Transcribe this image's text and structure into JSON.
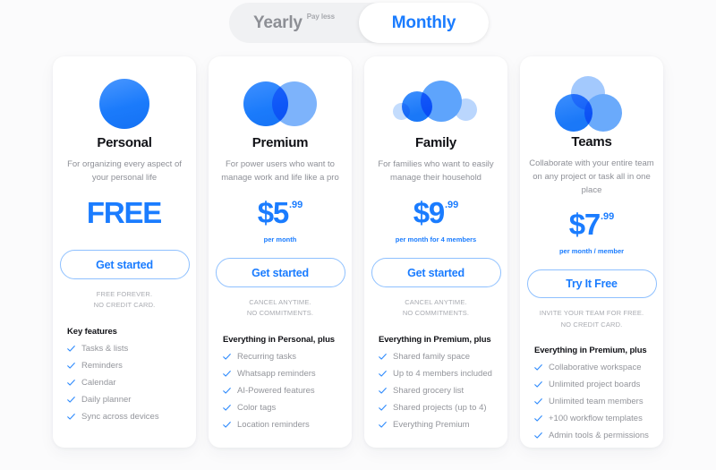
{
  "billing_toggle": {
    "options": [
      {
        "label": "Yearly",
        "badge": "Pay less",
        "selected": false
      },
      {
        "label": "Monthly",
        "badge": "",
        "selected": true
      }
    ]
  },
  "accent_color": "#1a7cff",
  "plans": [
    {
      "name": "Personal",
      "icon": "one-circle-icon",
      "description": "For organizing every aspect of your personal life",
      "price_main": "FREE",
      "price_cents": "",
      "price_period": "",
      "cta_label": "Get started",
      "fineprint": "FREE FOREVER.\nNO CREDIT CARD.",
      "features_heading": "Key features",
      "features": [
        "Tasks & lists",
        "Reminders",
        "Calendar",
        "Daily planner",
        "Sync across devices"
      ]
    },
    {
      "name": "Premium",
      "icon": "two-circles-icon",
      "description": "For power users who want to manage work and life like a pro",
      "price_main": "$5",
      "price_cents": ".99",
      "price_period": "per month",
      "cta_label": "Get started",
      "fineprint": "CANCEL ANYTIME.\nNO COMMITMENTS.",
      "features_heading": "Everything in Personal, plus",
      "features": [
        "Recurring tasks",
        "Whatsapp reminders",
        "AI-Powered features",
        "Color tags",
        "Location reminders"
      ]
    },
    {
      "name": "Family",
      "icon": "four-circles-icon",
      "description": "For families who want to easily manage their household",
      "price_main": "$9",
      "price_cents": ".99",
      "price_period": "per month for 4 members",
      "cta_label": "Get started",
      "fineprint": "CANCEL ANYTIME.\nNO COMMITMENTS.",
      "features_heading": "Everything in Premium, plus",
      "features": [
        "Shared family space",
        "Up to 4 members included",
        "Shared grocery list",
        "Shared projects (up to 4)",
        "Everything Premium"
      ]
    },
    {
      "name": "Teams",
      "icon": "three-circles-icon",
      "description": "Collaborate with your entire team on any project or task all in one place",
      "price_main": "$7",
      "price_cents": ".99",
      "price_period": "per month / member",
      "cta_label": "Try It Free",
      "fineprint": "INVITE YOUR TEAM FOR FREE.\nNO CREDIT CARD.",
      "features_heading": "Everything in Premium, plus",
      "features": [
        "Collaborative workspace",
        "Unlimited project boards",
        "Unlimited team members",
        "+100 workflow templates",
        "Admin tools & permissions"
      ]
    }
  ]
}
